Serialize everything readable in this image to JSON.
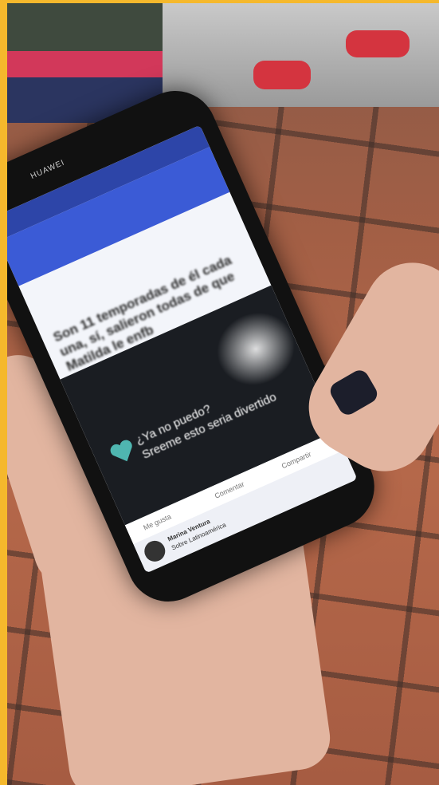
{
  "photo": {
    "subject": "hand holding smartphone over tiled floor",
    "phone_brand": "HUAWEI",
    "screen": {
      "headline": "Son 11 temporadas de él cada una, sí, salieron todas de que Matilda le enfb",
      "caption_line1": "¿Ya no puedo?",
      "caption_line2": "Sreeme esto seria divertido",
      "action_like": "Me gusta",
      "action_comment": "Comentar",
      "action_share": "Compartir",
      "commenter_name": "Marina Ventura",
      "commenter_text": "Sobre Latinoamérica"
    }
  },
  "colors": {
    "border": "#f5b82c",
    "app_blue": "#3b5bd6",
    "floor": "#a35f45",
    "nail": "#1c1e2b"
  }
}
